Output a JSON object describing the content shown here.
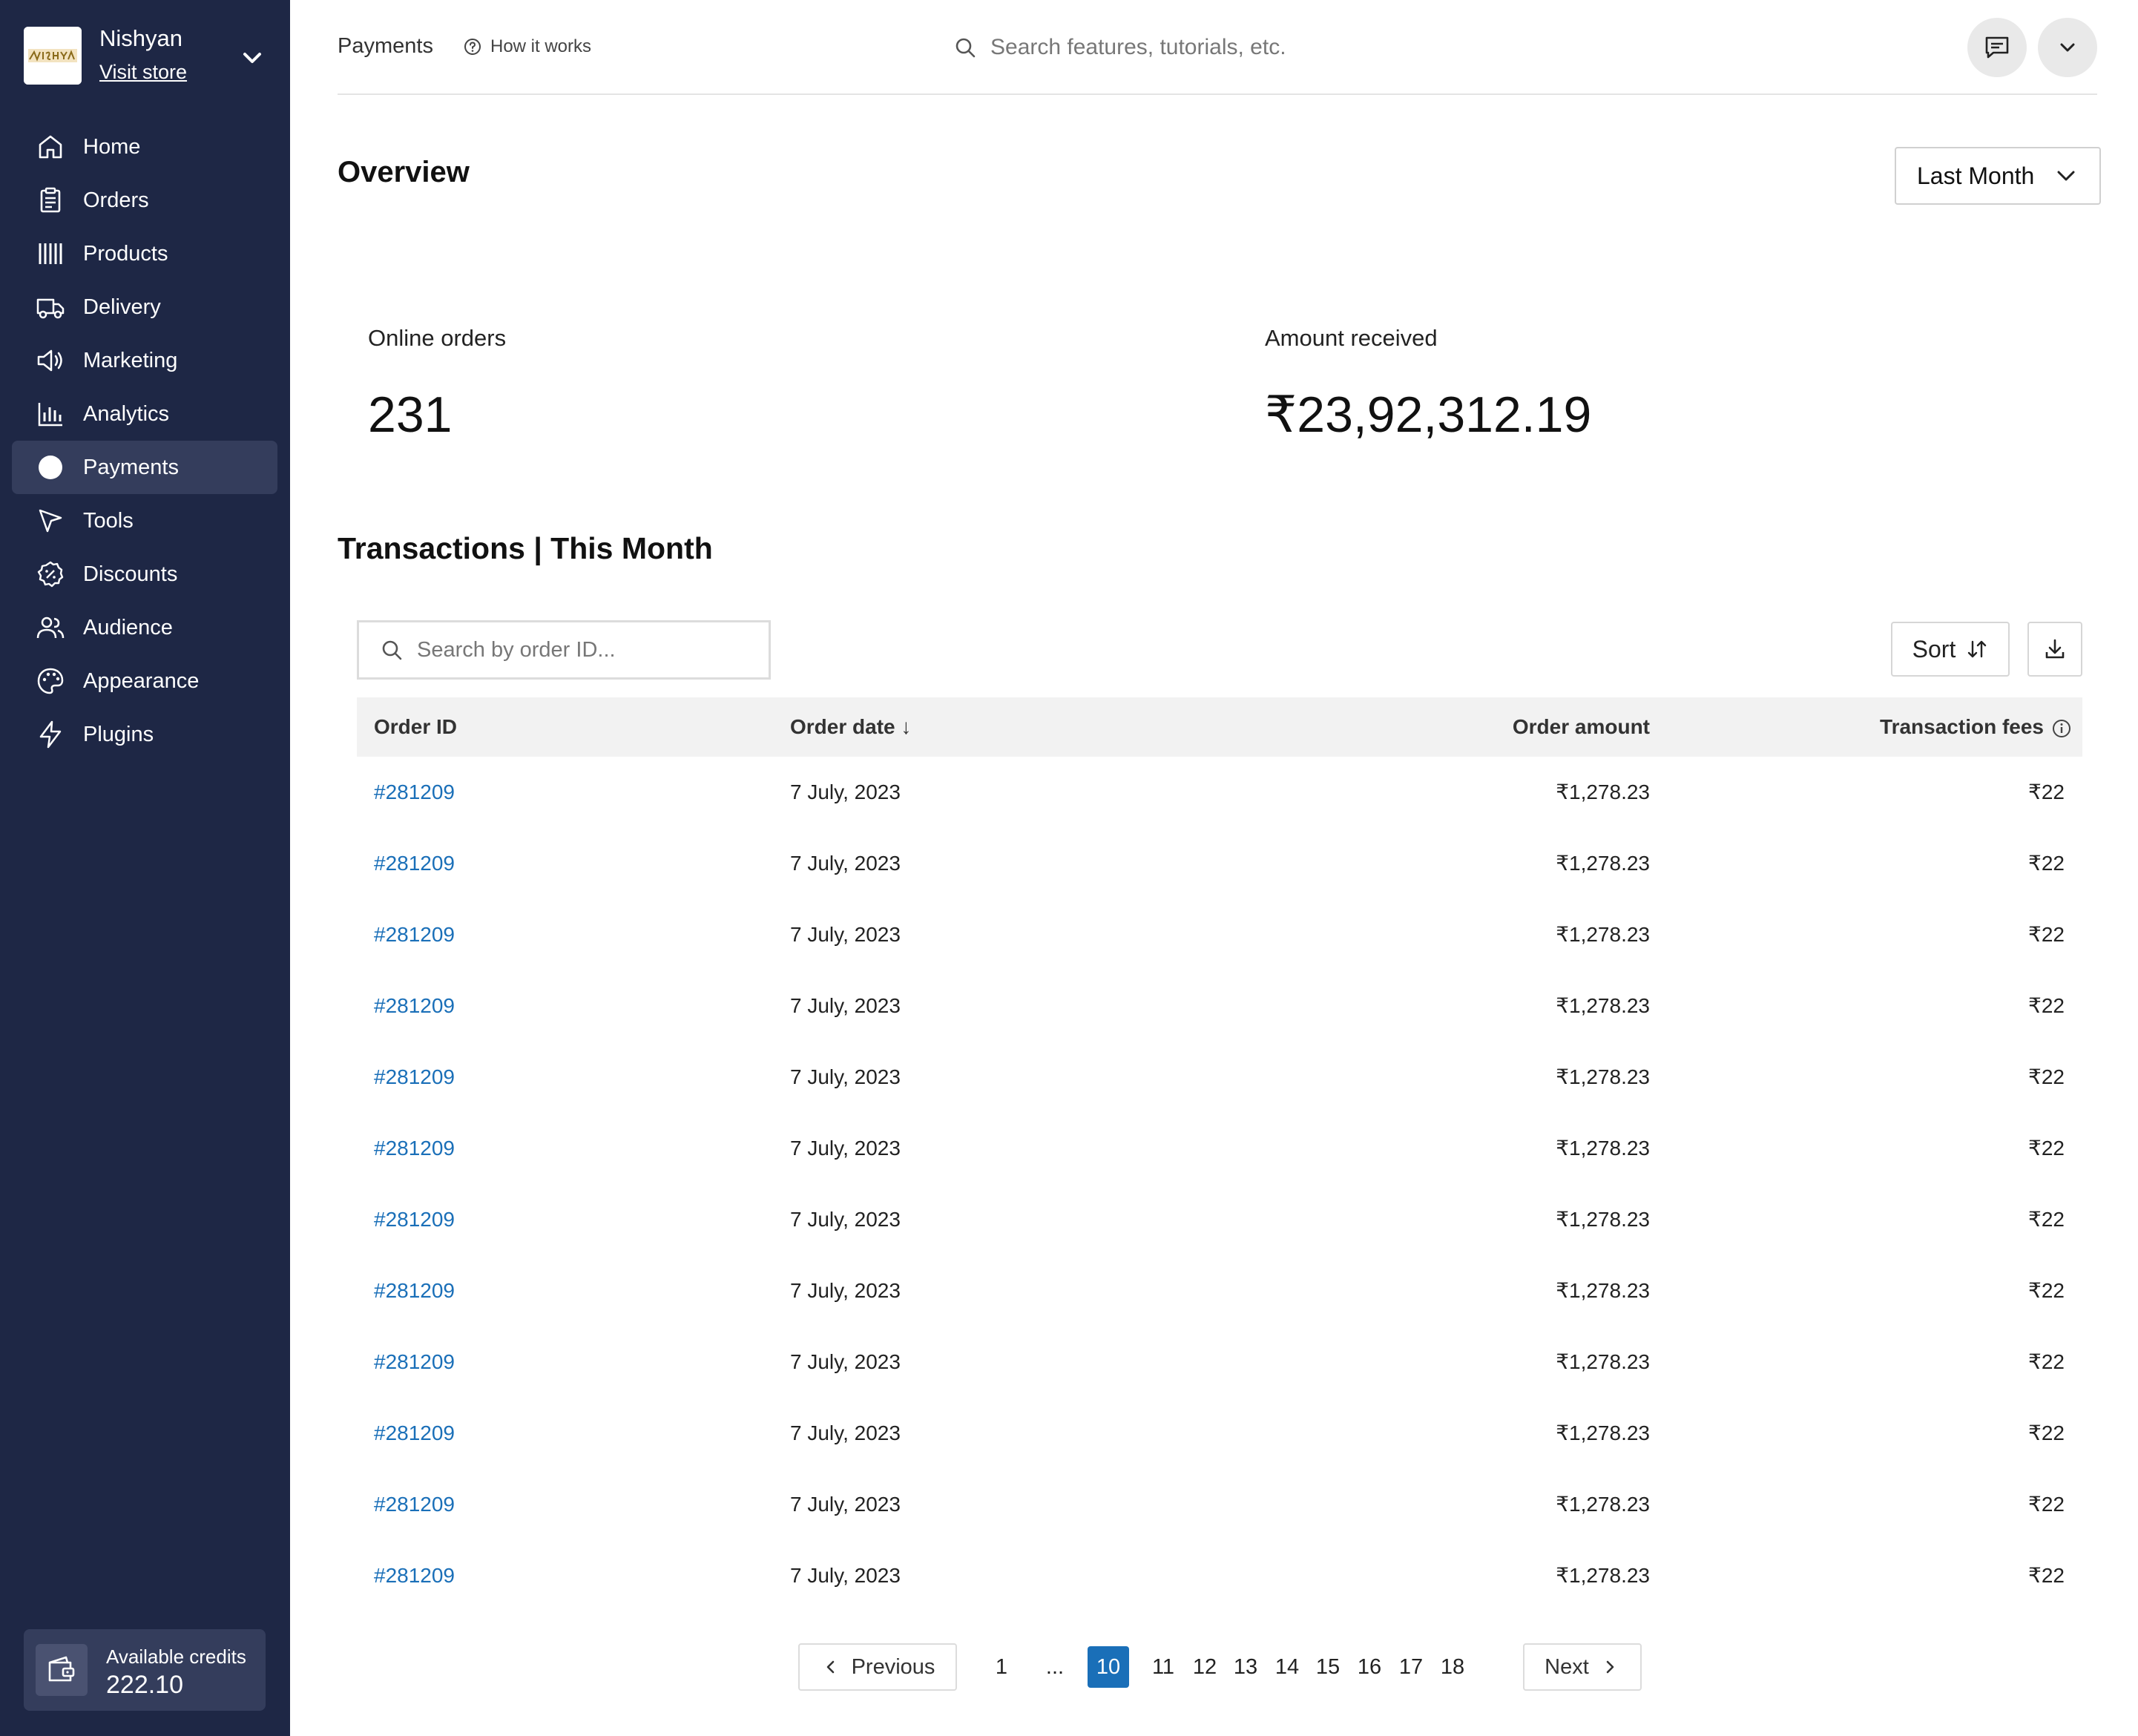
{
  "store": {
    "name": "Nishyan",
    "visit_label": "Visit store",
    "logo_text": "NISHYAN"
  },
  "sidebar": {
    "items": [
      {
        "label": "Home",
        "icon": "home-icon"
      },
      {
        "label": "Orders",
        "icon": "clipboard-icon"
      },
      {
        "label": "Products",
        "icon": "barcode-icon"
      },
      {
        "label": "Delivery",
        "icon": "truck-icon"
      },
      {
        "label": "Marketing",
        "icon": "megaphone-icon"
      },
      {
        "label": "Analytics",
        "icon": "bar-chart-icon"
      },
      {
        "label": "Payments",
        "icon": "payments-icon",
        "active": true
      },
      {
        "label": "Tools",
        "icon": "cursor-icon"
      },
      {
        "label": "Discounts",
        "icon": "discount-icon"
      },
      {
        "label": "Audience",
        "icon": "users-icon"
      },
      {
        "label": "Appearance",
        "icon": "palette-icon"
      },
      {
        "label": "Plugins",
        "icon": "lightning-icon"
      }
    ]
  },
  "credits": {
    "label": "Available credits",
    "value": "222.10"
  },
  "header": {
    "breadcrumb": "Payments",
    "how_it_works": "How it works",
    "search_placeholder": "Search features, tutorials, etc."
  },
  "overview": {
    "title": "Overview",
    "period": "Last Month",
    "stats": [
      {
        "label": "Online orders",
        "value": "231"
      },
      {
        "label": "Amount received",
        "value": "₹23,92,312.19"
      }
    ]
  },
  "transactions": {
    "title": "Transactions | This Month",
    "search_placeholder": "Search by order ID...",
    "sort_label": "Sort",
    "columns": {
      "order_id": "Order ID",
      "order_date": "Order date ↓",
      "order_amount": "Order amount",
      "transaction_fees": "Transaction fees"
    },
    "rows": [
      {
        "id": "#281209",
        "date": "7 July, 2023",
        "amount": "₹1,278.23",
        "fee": "₹22"
      },
      {
        "id": "#281209",
        "date": "7 July, 2023",
        "amount": "₹1,278.23",
        "fee": "₹22"
      },
      {
        "id": "#281209",
        "date": "7 July, 2023",
        "amount": "₹1,278.23",
        "fee": "₹22"
      },
      {
        "id": "#281209",
        "date": "7 July, 2023",
        "amount": "₹1,278.23",
        "fee": "₹22"
      },
      {
        "id": "#281209",
        "date": "7 July, 2023",
        "amount": "₹1,278.23",
        "fee": "₹22"
      },
      {
        "id": "#281209",
        "date": "7 July, 2023",
        "amount": "₹1,278.23",
        "fee": "₹22"
      },
      {
        "id": "#281209",
        "date": "7 July, 2023",
        "amount": "₹1,278.23",
        "fee": "₹22"
      },
      {
        "id": "#281209",
        "date": "7 July, 2023",
        "amount": "₹1,278.23",
        "fee": "₹22"
      },
      {
        "id": "#281209",
        "date": "7 July, 2023",
        "amount": "₹1,278.23",
        "fee": "₹22"
      },
      {
        "id": "#281209",
        "date": "7 July, 2023",
        "amount": "₹1,278.23",
        "fee": "₹22"
      },
      {
        "id": "#281209",
        "date": "7 July, 2023",
        "amount": "₹1,278.23",
        "fee": "₹22"
      },
      {
        "id": "#281209",
        "date": "7 July, 2023",
        "amount": "₹1,278.23",
        "fee": "₹22"
      }
    ]
  },
  "pagination": {
    "previous_label": "Previous",
    "next_label": "Next",
    "pages": [
      "1",
      "...",
      "10",
      "11",
      "12",
      "13",
      "14",
      "15",
      "16",
      "17",
      "18"
    ],
    "current": "10"
  },
  "colors": {
    "sidebar_bg": "#1e2745",
    "sidebar_active": "#343d5c",
    "link": "#1a6fb8",
    "accent": "#1a6fb8"
  }
}
